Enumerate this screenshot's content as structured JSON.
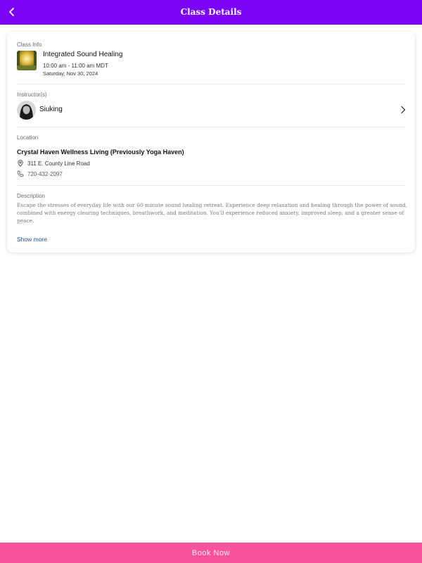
{
  "header": {
    "title": "Class Details",
    "back_icon": "chevron-left-icon"
  },
  "class_info": {
    "label": "Class Info",
    "name": "Integrated Sound Healing",
    "time": "10:00 am - 11:00 am MDT",
    "date": "Saturday, Nov 30, 2024"
  },
  "instructor": {
    "label": "Instructor(s)",
    "name": "Siuking",
    "chevron_icon": "chevron-right-icon"
  },
  "location": {
    "label": "Location",
    "name": "Crystal Haven Wellness Living (Previously Yoga Haven)",
    "address": "311 E. County Line Road",
    "phone": "720-432-2097",
    "address_icon": "map-pin-icon",
    "phone_icon": "phone-icon"
  },
  "description": {
    "label": "Description",
    "text": "Escape the stresses of everyday life with our 60-minute sound healing retreat. Experience deep relaxation and healing through the power of sound, combined with energy clearing techniques, breathwork, and meditation. You'll experience reduced anxiety, improved sleep, and a greater sense of peace.",
    "ellipsis": "...",
    "show_more": "Show more"
  },
  "footer": {
    "book_label": "Book Now"
  },
  "colors": {
    "header_bg": "#7c02f6",
    "button_bg": "#f8549e",
    "link": "#1f4f91"
  }
}
